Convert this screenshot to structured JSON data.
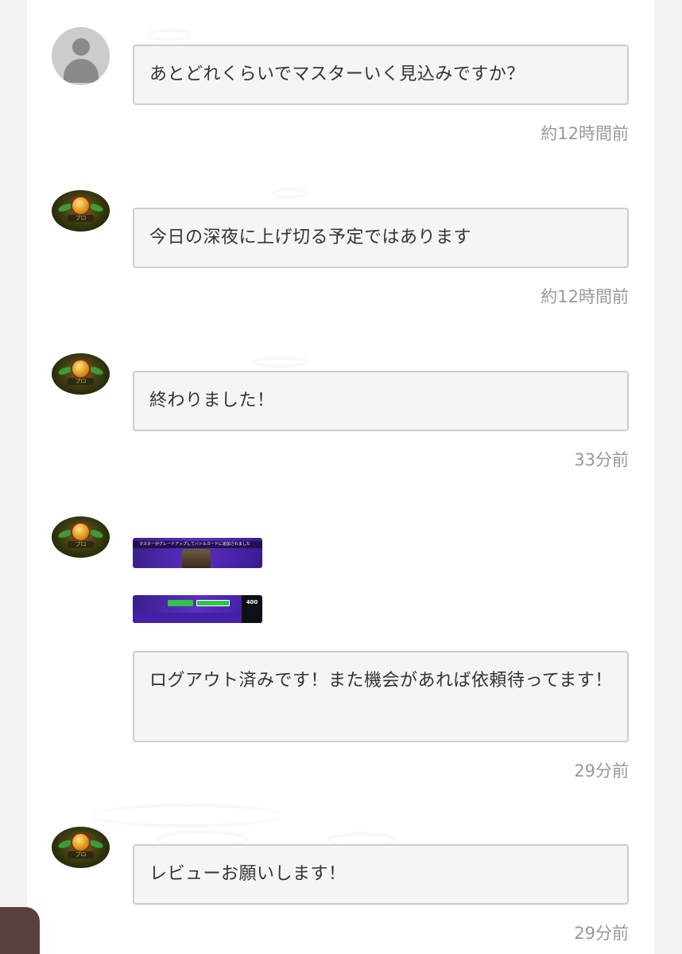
{
  "messages": [
    {
      "text": "あとどれくらいでマスターいく見込みですか？",
      "time": "約12時間前",
      "avatar": "default-user-icon"
    },
    {
      "text": "今日の深夜に上げ切る予定ではあります",
      "time": "約12時間前",
      "avatar": "rank-emblem"
    },
    {
      "text": "終わりました！",
      "time": "33分前",
      "avatar": "rank-emblem"
    },
    {
      "text": "ログアウト済みです！また機会があれば依頼待ってます！",
      "time": "29分前",
      "avatar": "rank-emblem",
      "attachments": [
        {
          "caption": "マスターがグレードアップしてバトルカードに追加されました"
        },
        {
          "corner_label": "400"
        }
      ]
    },
    {
      "text": "レビューお願いします！",
      "time": "29分前",
      "avatar": "rank-emblem"
    }
  ],
  "emblem_label": "プロ",
  "colors": {
    "bubble_bg": "#f5f5f5",
    "bubble_border": "#cdcdcd",
    "time_text": "#999999",
    "text": "#333333"
  }
}
